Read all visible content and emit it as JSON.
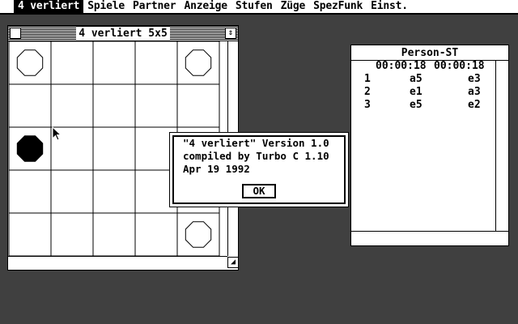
{
  "menubar": {
    "items": [
      {
        "label": "4 verliert",
        "active": true
      },
      {
        "label": "Spiele"
      },
      {
        "label": "Partner"
      },
      {
        "label": "Anzeige"
      },
      {
        "label": "Stufen"
      },
      {
        "label": "Züge"
      },
      {
        "label": "SpezFunk"
      },
      {
        "label": "Einst."
      }
    ]
  },
  "board_window": {
    "title": "4 verliert 5x5",
    "full_icon": "⇕",
    "size_icon": "◢",
    "board": {
      "rows": 5,
      "cols": 5,
      "white_pieces": [
        [
          0,
          0
        ],
        [
          0,
          4
        ],
        [
          4,
          4
        ]
      ],
      "black_pieces": [
        [
          2,
          0
        ]
      ]
    }
  },
  "about_dialog": {
    "line1": "\"4 verliert\" Version 1.0",
    "line2": "compiled by Turbo C 1.10",
    "line3": "Apr 19 1992",
    "ok_label": "OK"
  },
  "moves_window": {
    "title": "Person-ST",
    "time_white": "00:00:18",
    "time_black": "00:00:18",
    "moves": [
      {
        "num": "1",
        "white": "a5",
        "black": "e3"
      },
      {
        "num": "2",
        "white": "e1",
        "black": "a3"
      },
      {
        "num": "3",
        "white": "e5",
        "black": "e2"
      }
    ]
  },
  "colors": {
    "foreground": "#000000",
    "background": "#ffffff"
  }
}
